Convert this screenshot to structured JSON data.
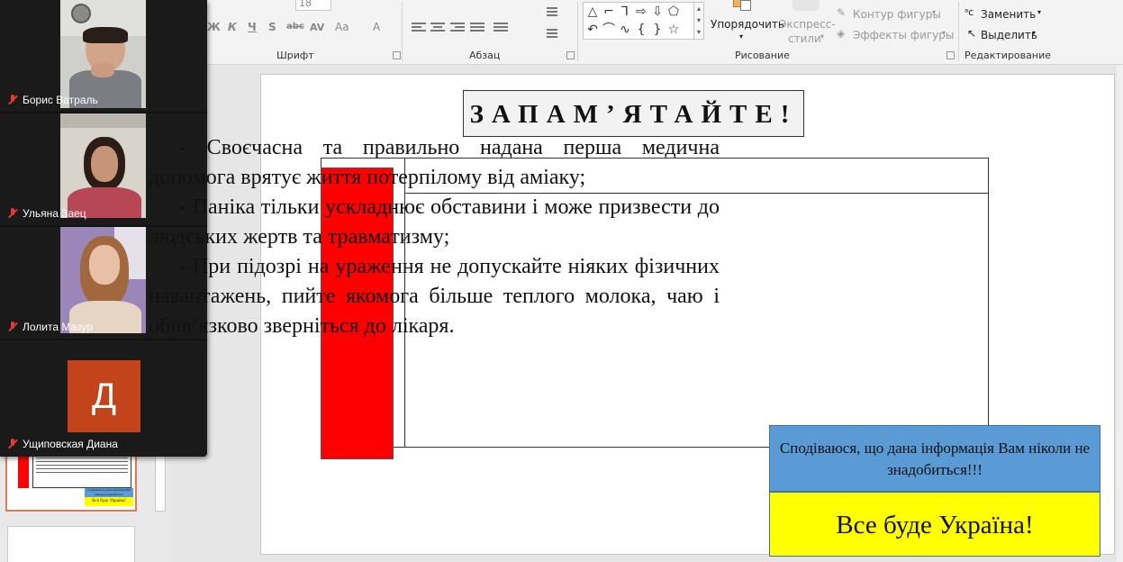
{
  "ribbon": {
    "groups": {
      "font": "Шрифт",
      "paragraph": "Абзац",
      "drawing": "Рисование",
      "editing": "Редактирование"
    },
    "font_size": "18",
    "font_buttons": [
      "Ж",
      "К",
      "Ч",
      "S",
      "abc",
      "AV",
      "Aa",
      "A"
    ],
    "drawing": {
      "arrange": "Упорядочить",
      "quick_styles_1": "Экспресс-",
      "quick_styles_2": "стили",
      "shape_outline": "Контур фигуры",
      "shape_effects": "Эффекты фигуры"
    },
    "editing": {
      "replace": "Заменить",
      "select": "Выделить"
    }
  },
  "participants": [
    {
      "name": "Борис Ватраль",
      "muted": true
    },
    {
      "name": "Ульяна Заец",
      "muted": true
    },
    {
      "name": "Лолита Мазур",
      "muted": true
    },
    {
      "name": "Ущиповская Диана",
      "muted": true,
      "avatar_letter": "Д",
      "avatar_color": "#c3431a"
    }
  ],
  "slide": {
    "title": "ЗАПАМ’ЯТАЙТЕ!",
    "paragraphs": [
      "- Своєчасна та правильно надана перша медична допомога врятує життя потерпілому від аміаку;",
      "- Паніка тільки ускладнює обставини і може призвести до людських жертв та травматизму;",
      "- При підозрі на ураження не допускайте ніяких фізичних навантажень, пийте якомога більше теплого молока, чаю і обов’язково зверніться до лікаря."
    ],
    "note_blue": "Сподіваюся, що дана інформація Вам ніколи не знадобиться!!!",
    "note_yellow": "Все буде Україна!",
    "colors": {
      "red_bar": "#ff0000",
      "blue_box": "#5b9bd5",
      "yellow_box": "#ffff00"
    }
  },
  "thumbnail": {
    "note_blue": "Сподіваюся, що дана інформація Вам ніколи не знадобиться!!!",
    "note_yellow": "Все буде Україна!"
  }
}
